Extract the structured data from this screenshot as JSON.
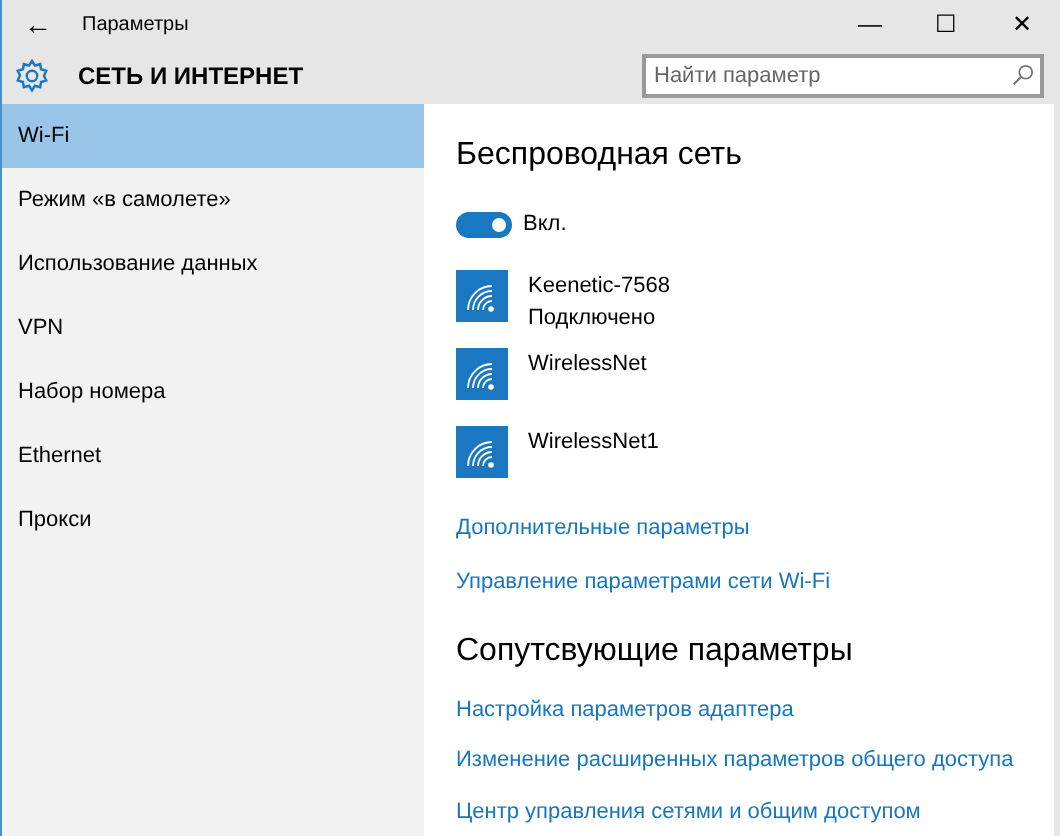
{
  "window": {
    "title": "Параметры",
    "back": "←",
    "controls": [
      "—",
      "☐",
      "✕"
    ]
  },
  "header": {
    "title": "СЕТЬ И ИНТЕРНЕТ",
    "search": {
      "placeholder": "Найти параметр"
    }
  },
  "sidebar": {
    "items": [
      {
        "label": "Wi-Fi",
        "selected": true
      },
      {
        "label": "Режим «в самолете»",
        "selected": false
      },
      {
        "label": "Использование данных",
        "selected": false
      },
      {
        "label": "VPN",
        "selected": false
      },
      {
        "label": "Набор номера",
        "selected": false
      },
      {
        "label": "Ethernet",
        "selected": false
      },
      {
        "label": "Прокси",
        "selected": false
      }
    ]
  },
  "content": {
    "title": "Беспроводная сеть",
    "toggle": {
      "on": true,
      "label": "Вкл."
    },
    "networks": [
      {
        "name": "Keenetic-7568",
        "status": "Подключено"
      },
      {
        "name": "WirelessNet"
      },
      {
        "name": "WirelessNet1"
      }
    ],
    "links": [
      "Дополнительные параметры",
      "Управление параметрами сети Wi-Fi"
    ],
    "related_title": "Сопутсвующие параметры",
    "related_links": [
      "Настройка параметров адаптера",
      "Изменение расширенных параметров общего доступа",
      "Центр управления сетями и общим доступом"
    ]
  }
}
